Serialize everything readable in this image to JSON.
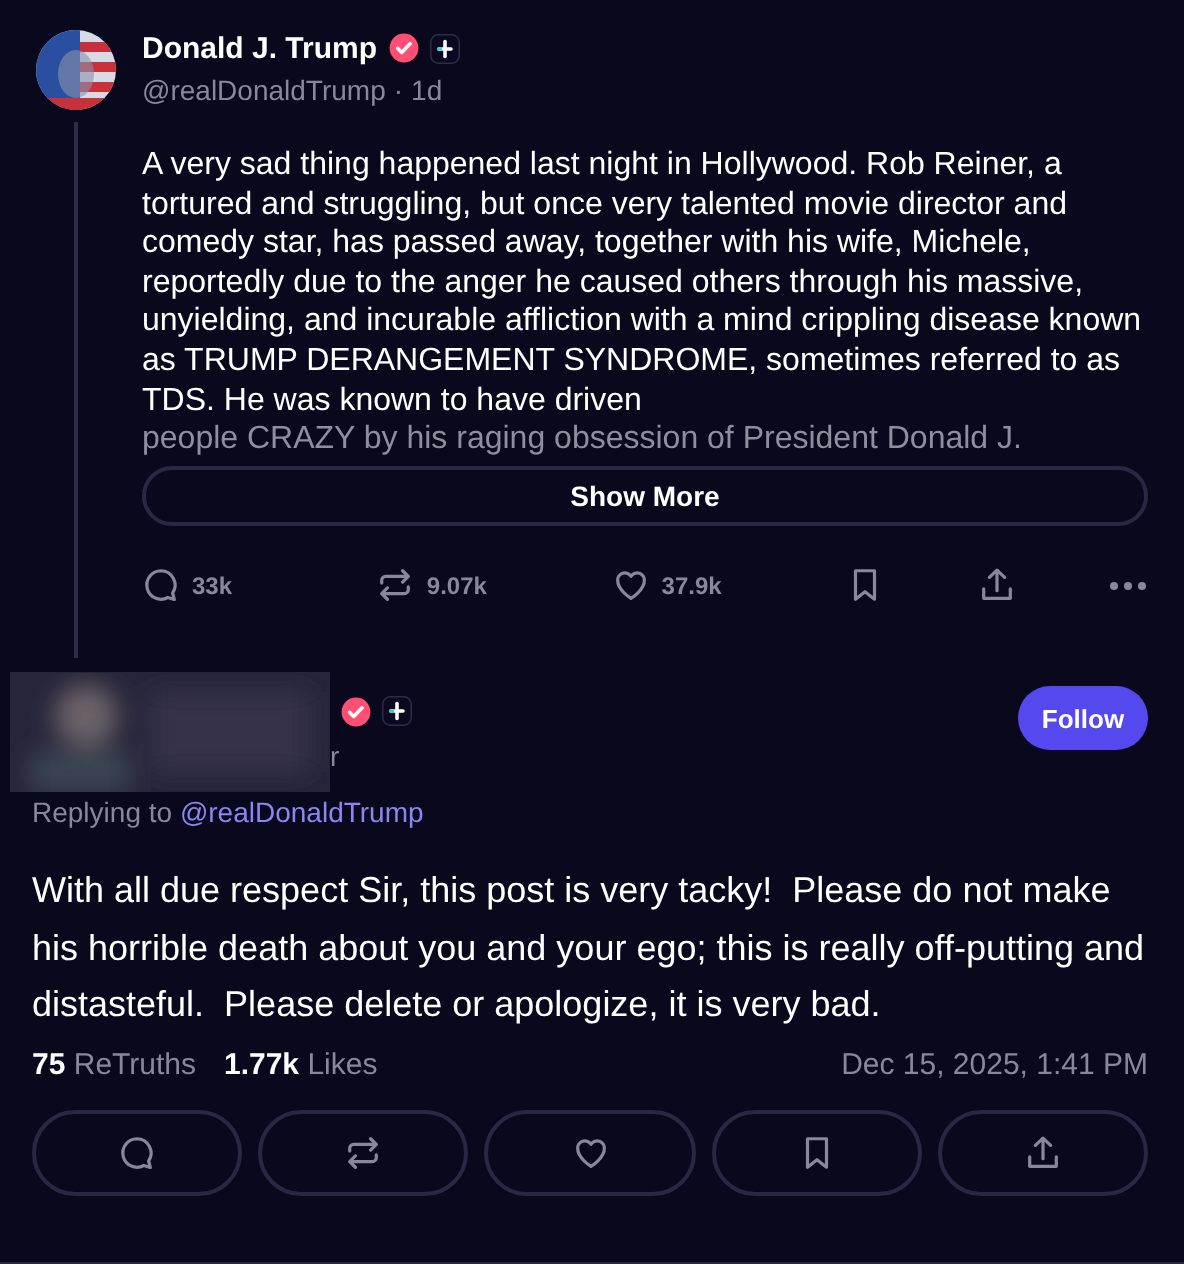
{
  "post": {
    "author": {
      "name": "Donald J. Trump",
      "verified": true,
      "handle": "@realDonaldTrump",
      "separator": "·",
      "time": "1d"
    },
    "text": [
      "A very sad thing happened last night in Hollywood. Rob Reiner, a tortured and struggling, but once very talented movie director and comedy star, has passed away, together with his wife, Michele, reportedly due to the anger he caused others through his massive, unyielding, and incurable affliction with a mind crippling disease known as TRUMP DERANGEMENT SYNDROME, sometimes referred to as TDS. He was known to have driven",
      "people CRAZY by his raging obsession of President Donald J."
    ],
    "show_more": "Show More",
    "actions": [
      {
        "kind": "reply",
        "count": "33k"
      },
      {
        "kind": "retruth",
        "count": "9.07k"
      },
      {
        "kind": "like",
        "count": "37.9k"
      },
      {
        "kind": "bookmark"
      },
      {
        "kind": "share"
      },
      {
        "kind": "more"
      }
    ]
  },
  "reply": {
    "author": {
      "verified": true,
      "handle_fragment": "r"
    },
    "follow": "Follow",
    "replying_prefix": "Replying to",
    "replying_to": "@realDonaldTrump",
    "text": "With all due respect Sir, this post is very tacky!  Please do not make his horrible death about you and your ego; this is really off-putting and distasteful.  Please delete or apologize, it is very bad.",
    "stats": [
      {
        "count": "75",
        "label": "ReTruths"
      },
      {
        "count": "1.77k",
        "label": "Likes"
      }
    ],
    "date": "Dec 15, 2025, 1:41 PM",
    "buttons": [
      {
        "kind": "reply"
      },
      {
        "kind": "retruth"
      },
      {
        "kind": "like"
      },
      {
        "kind": "bookmark"
      },
      {
        "kind": "share"
      }
    ]
  }
}
